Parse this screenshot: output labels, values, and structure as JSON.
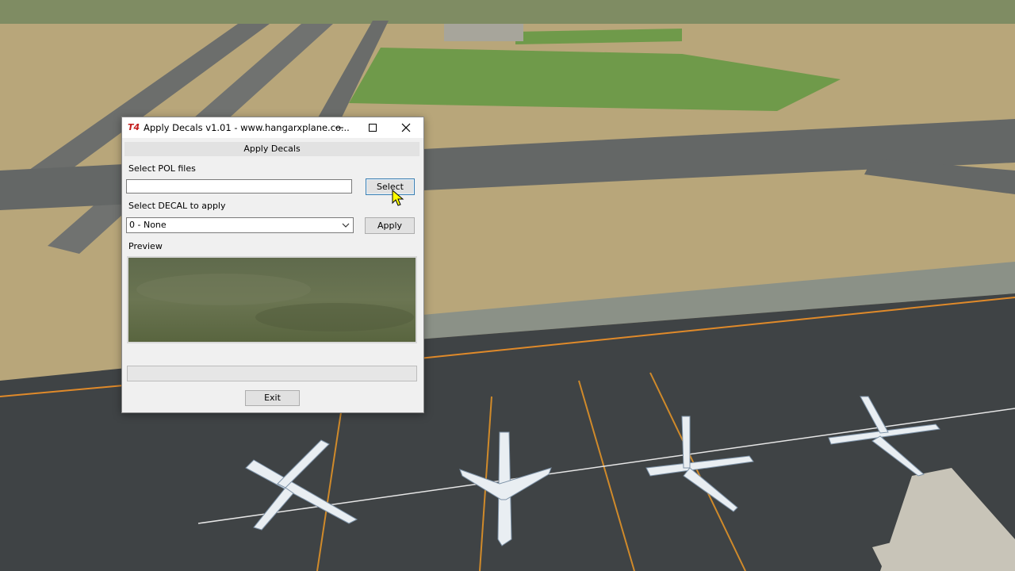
{
  "window": {
    "title": "Apply Decals v1.01 - www.hangarxplane.co...",
    "app_icon": "T4",
    "controls": [
      "minimize-icon",
      "maximize-icon",
      "close-icon"
    ]
  },
  "header": {
    "label": "Apply Decals"
  },
  "pol": {
    "label": "Select POL files",
    "value": "",
    "select_button": "Select"
  },
  "decal": {
    "label": "Select DECAL to apply",
    "selected": "0 - None",
    "apply_button": "Apply"
  },
  "preview": {
    "label": "Preview"
  },
  "footer": {
    "exit_button": "Exit"
  },
  "colors": {
    "accent_border": "#3c7fb1",
    "window_bg": "#f0f0f0",
    "app_icon": "#c41d1d",
    "cursor": "#ffff00"
  }
}
